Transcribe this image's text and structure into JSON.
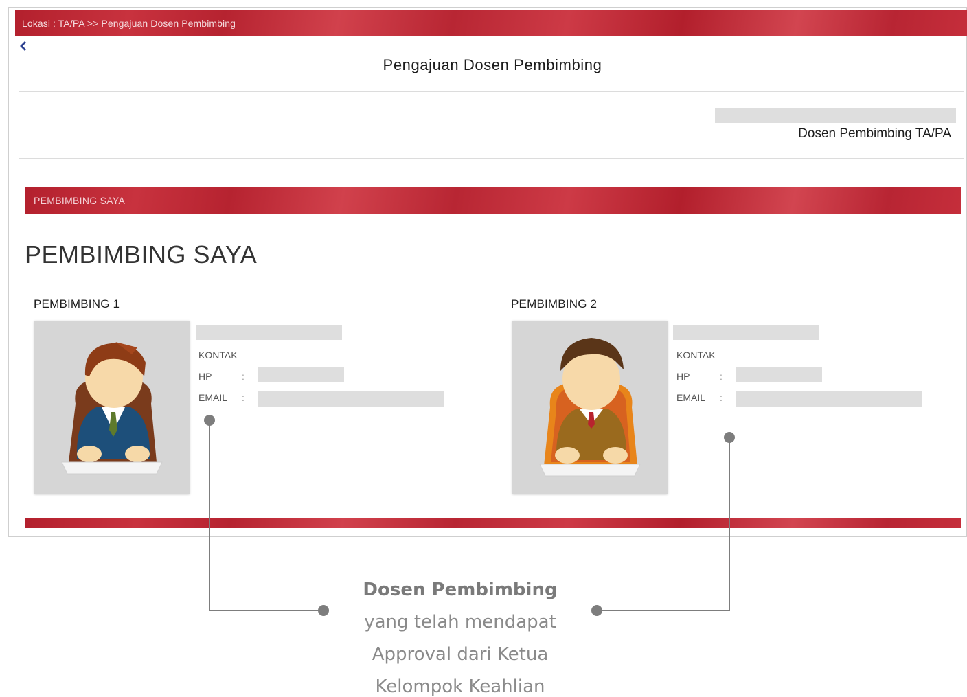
{
  "breadcrumb": "Lokasi : TA/PA >> Pengajuan Dosen Pembimbing",
  "back_icon": "chevron-left-icon",
  "page_title": "Pengajuan Dosen Pembimbing",
  "right_label": "Dosen Pembimbing TA/PA",
  "section_bar_label": "PEMBIMBING SAYA",
  "section_heading": "PEMBIMBING SAYA",
  "pembimbing": [
    {
      "title": "PEMBIMBING 1",
      "kontak_label": "KONTAK",
      "hp_label": "HP",
      "email_label": "EMAIL",
      "colon": ":",
      "avatar": "teacher-avatar-blue-suit"
    },
    {
      "title": "PEMBIMBING 2",
      "kontak_label": "KONTAK",
      "hp_label": "HP",
      "email_label": "EMAIL",
      "colon": ":",
      "avatar": "teacher-avatar-brown-sweater"
    }
  ],
  "caption": {
    "line1": "Dosen Pembimbing",
    "line2": "yang telah mendapat",
    "line3": "Approval dari Ketua",
    "line4": "Kelompok Keahlian"
  },
  "colors": {
    "brand_red": "#b8232f",
    "placeholder_gray": "#dedede",
    "back_blue": "#2b3f8f",
    "connector_gray": "#7d7d7d"
  }
}
